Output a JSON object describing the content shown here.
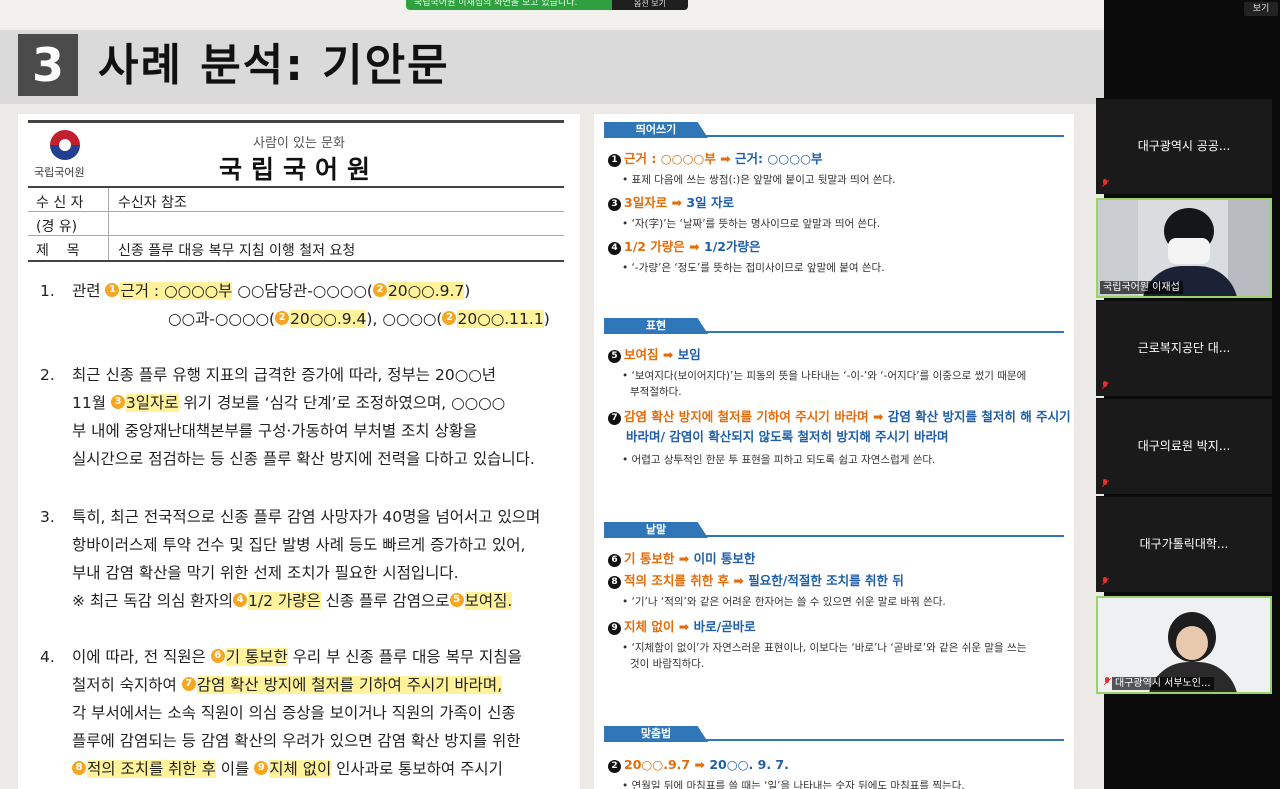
{
  "banner": {
    "message": "국립국어원 이재섭의 화면을 보고 있습니다.",
    "options_label": "옵션 보기"
  },
  "view_label": "보기",
  "title": {
    "number": "3",
    "text": "사례 분석: 기안문"
  },
  "document": {
    "logo_text": "국립국어원",
    "subtitle": "사람이 있는 문화",
    "org": "국립국어원",
    "meta": [
      {
        "key": "수 신 자",
        "value": "수신자 참조"
      },
      {
        "key": "(경 유)",
        "value": ""
      },
      {
        "key": "제    목",
        "value": "신종 플루 대응 복무 지침 이행 철저 요청"
      }
    ],
    "p1": {
      "num": "1.",
      "pre": "관련",
      "m1": "1",
      "t1": "근거 : ○○○○부",
      "mid1": " ○○담당관-○○○○(",
      "m2": "2",
      "t2": "20○○.9.7",
      "end1": ")",
      "l2_pre": "○○과-○○○○(",
      "m3": "2",
      "t3": "20○○.9.4",
      "l2_mid": "), ○○○○(",
      "m4": "2",
      "t4": "20○○.11.1",
      "l2_end": ")"
    },
    "p2": {
      "num": "2.",
      "l1": "최근 신종 플루 유행 지표의 급격한 증가에 따라, 정부는 20○○년",
      "l2_pre": "11월",
      "m": "3",
      "hl": "3일자로",
      "l2_post": " 위기 경보를 ‘심각 단계’로 조정하였으며, ○○○○",
      "l3": "부 내에 중앙재난대책본부를 구성·가동하여 부처별 조치 상황을",
      "l4": "실시간으로 점검하는 등 신종 플루 확산 방지에 전력을 다하고 있습니다."
    },
    "p3": {
      "num": "3.",
      "l1": "특히, 최근 전국적으로 신종 플루 감염 사망자가 40명을 넘어서고 있으며",
      "l2": "항바이러스제 투약 건수 및 집단 발병 사례 등도 빠르게 증가하고 있어,",
      "l3": "부내 감염 확산을 막기 위한 선제 조치가 필요한 시점입니다.",
      "l4_pre": "※ 최근 독감 의심 환자의",
      "m1": "4",
      "hl1": "1/2 가량은",
      "l4_mid": " 신종 플루 감염으로",
      "m2": "5",
      "hl2": "보여짐."
    },
    "p4": {
      "num": "4.",
      "l1_pre": "이에 따라, 전 직원은",
      "m1": "6",
      "hl1": "기 통보한",
      "l1_post": " 우리 부 신종 플루 대응 복무 지침을",
      "l2_pre": "철저히 숙지하여",
      "m2": "7",
      "hl2": "감염 확산 방지에 철저를 기하여 주시기 바라며,",
      "l3": "각 부서에서는 소속 직원이 의심 증상을 보이거나 직원의 가족이 신종",
      "l4": "플루에 감염되는 등 감염 확산의 우려가 있으면 감염 확산 방지를 위한",
      "m3": "8",
      "hl3": "적의 조치를 취한 후",
      "l5_mid": " 이를",
      "m4": "9",
      "hl4": "지체 없이",
      "l5_post": " 인사과로 통보하여 주시기"
    }
  },
  "panel": {
    "s1": "띄어쓰기",
    "i1": {
      "n": "1",
      "wrong": "근거 : ○○○○부",
      "arr": "➡",
      "right": "근거: ○○○○부",
      "note": "• 표제 다음에 쓰는 쌍점(:)은 앞말에 붙이고 뒷말과 띄어 쓴다."
    },
    "i3": {
      "n": "3",
      "wrong": "3일자로",
      "arr": "➡",
      "right": "3일 자로",
      "note": "• ‘자(字)’는 ‘날짜’를 뜻하는 명사이므로 앞말과 띄어 쓴다."
    },
    "i4": {
      "n": "4",
      "wrong": "1/2 가량은",
      "arr": "➡",
      "right": "1/2가량은",
      "note": "• ‘-가량’은 ‘정도’를 뜻하는 접미사이므로 앞말에 붙여 쓴다."
    },
    "s2": "표현",
    "i5": {
      "n": "5",
      "wrong": "보여짐",
      "arr": "➡",
      "right": "보임",
      "note1": "• ‘보여지다(보이어지다)’는 피동의 뜻을 나타내는 ‘-이-’와 ‘-어지다’를 이중으로 썼기 때문에",
      "note2": "부적절하다."
    },
    "i7": {
      "n": "7",
      "wrong": "감염 확산 방지에 철저를 기하여 주시기 바라며",
      "arr": "➡",
      "right1": "감염 확산 방지를 철저히 해 주시기",
      "right2": "바라며/ 감염이 확산되지 않도록 철저히 방지해 주시기 바라며",
      "note": "• 어렵고 상투적인 한문 투 표현을 피하고 되도록 쉽고 자연스럽게 쓴다."
    },
    "s3": "낱말",
    "i6": {
      "n": "6",
      "wrong": "기 통보한",
      "arr": "➡",
      "right": "이미 통보한"
    },
    "i8": {
      "n": "8",
      "wrong": "적의 조치를 취한 후",
      "arr": "➡",
      "right": "필요한/적절한 조치를 취한 뒤",
      "note": "• ‘기’나 ‘적의’와 같은 어려운 한자어는 쓸 수 있으면 쉬운 말로 바꿔 쓴다."
    },
    "i9": {
      "n": "9",
      "wrong": "지체 없이",
      "arr": "➡",
      "right": "바로/곧바로",
      "note1": "• ‘지체함이 없이’가 자연스러운 표현이나, 이보다는 ‘바로’나 ‘곧바로’와 같은 쉬운 말을 쓰는",
      "note2": "것이 바람직하다."
    },
    "s4": "맞춤법",
    "i2": {
      "n": "2",
      "wrong": "20○○.9.7",
      "arr": "➡",
      "right": "20○○. 9. 7.",
      "note": "• 연월일 뒤에 마침표를 쓸 때는 ‘일’을 나타내는 숫자 뒤에도 마침표를 찍는다."
    }
  },
  "participants": [
    {
      "name": "대구광역시 공공..."
    },
    {
      "name": "국립국어원 이재섭"
    },
    {
      "name": "근로복지공단 대..."
    },
    {
      "name": "대구의료원 박지..."
    },
    {
      "name": "대구가톨릭대학..."
    },
    {
      "name": "대구광역시 서부노인..."
    }
  ]
}
